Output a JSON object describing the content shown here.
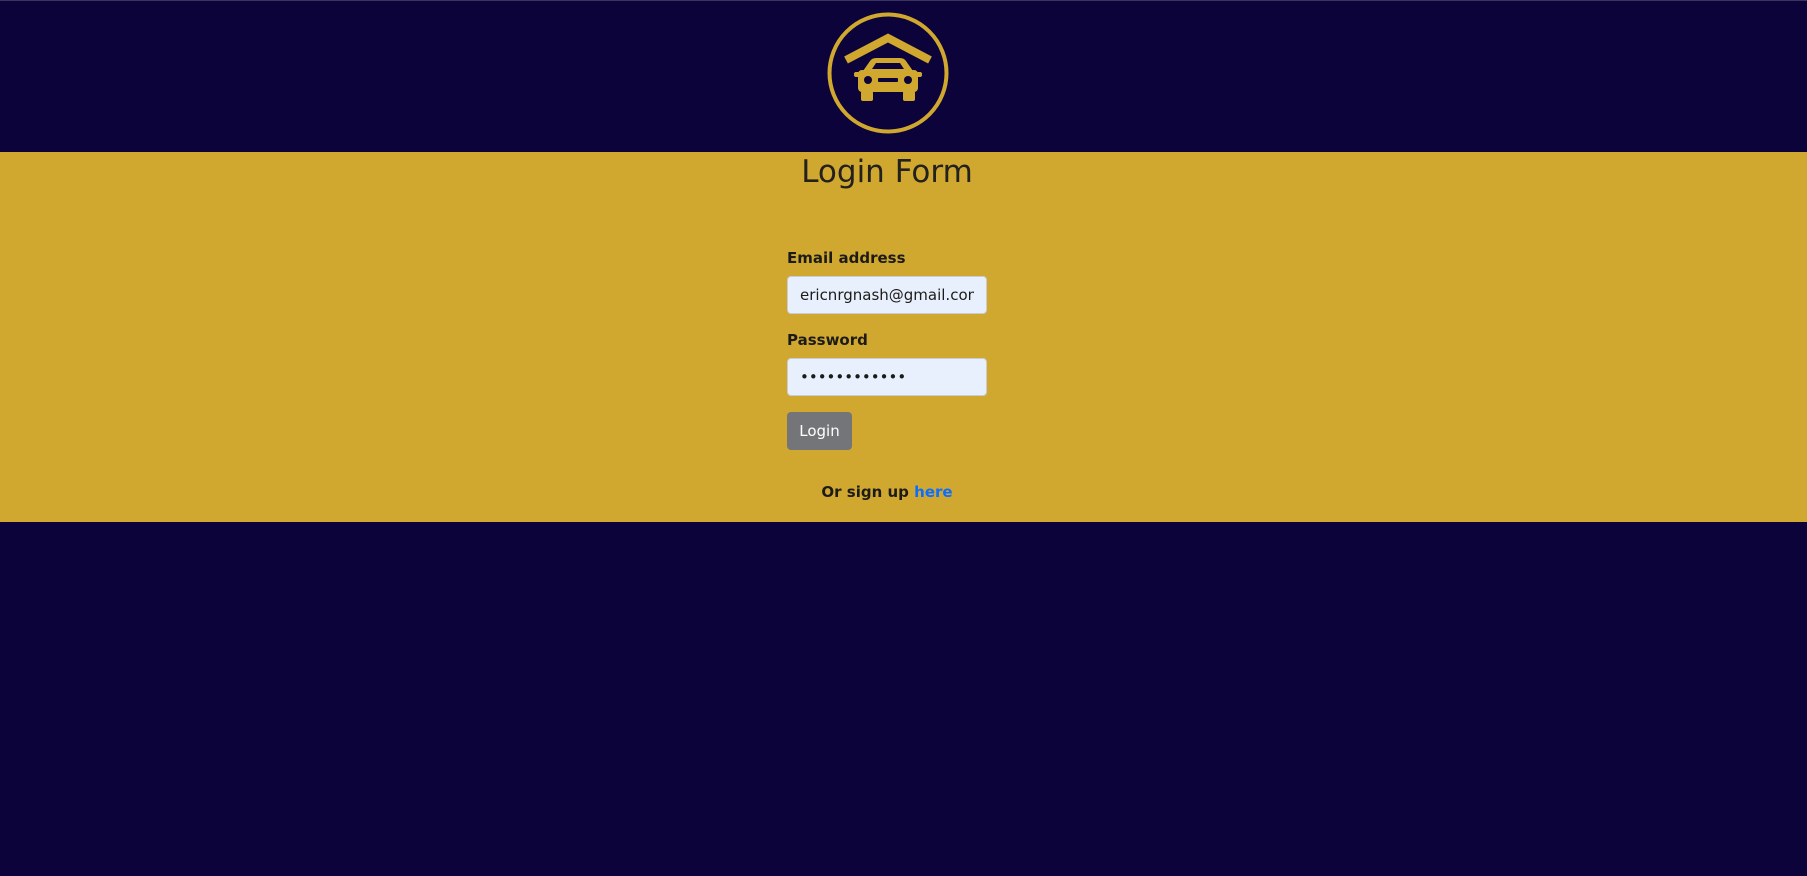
{
  "header": {
    "logo_icon": "garage-car-icon",
    "brand_color": "#d1a82f",
    "background_color": "#0b033a"
  },
  "form": {
    "title": "Login Form",
    "email_label": "Email address",
    "email_value": "ericnrgnash@gmail.com",
    "password_label": "Password",
    "password_value": "••••••••••••",
    "login_button": "Login",
    "signup_prefix": "Or sign up ",
    "signup_link": "here"
  },
  "colors": {
    "form_background": "#d1a82f",
    "button_background": "#737578",
    "link_color": "#0d6efd",
    "input_background": "#e8f0fe"
  }
}
